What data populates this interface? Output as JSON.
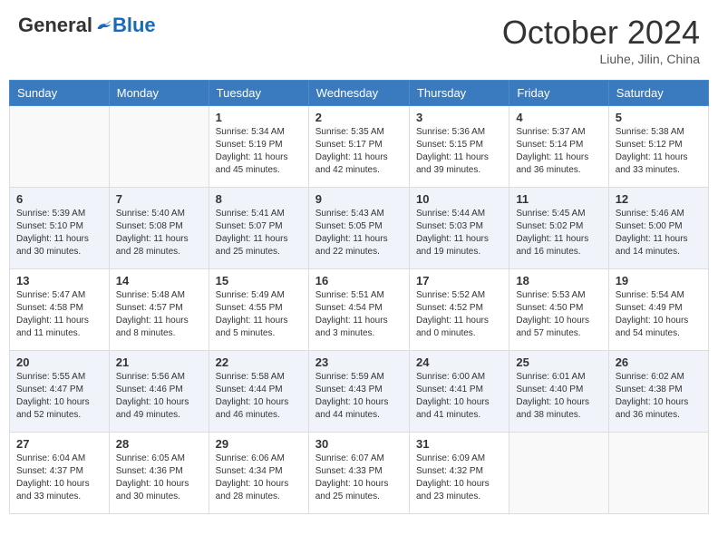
{
  "header": {
    "logo_general": "General",
    "logo_blue": "Blue",
    "month": "October 2024",
    "location": "Liuhe, Jilin, China"
  },
  "days_of_week": [
    "Sunday",
    "Monday",
    "Tuesday",
    "Wednesday",
    "Thursday",
    "Friday",
    "Saturday"
  ],
  "weeks": [
    [
      {
        "day": "",
        "info": ""
      },
      {
        "day": "",
        "info": ""
      },
      {
        "day": "1",
        "info": "Sunrise: 5:34 AM\nSunset: 5:19 PM\nDaylight: 11 hours and 45 minutes."
      },
      {
        "day": "2",
        "info": "Sunrise: 5:35 AM\nSunset: 5:17 PM\nDaylight: 11 hours and 42 minutes."
      },
      {
        "day": "3",
        "info": "Sunrise: 5:36 AM\nSunset: 5:15 PM\nDaylight: 11 hours and 39 minutes."
      },
      {
        "day": "4",
        "info": "Sunrise: 5:37 AM\nSunset: 5:14 PM\nDaylight: 11 hours and 36 minutes."
      },
      {
        "day": "5",
        "info": "Sunrise: 5:38 AM\nSunset: 5:12 PM\nDaylight: 11 hours and 33 minutes."
      }
    ],
    [
      {
        "day": "6",
        "info": "Sunrise: 5:39 AM\nSunset: 5:10 PM\nDaylight: 11 hours and 30 minutes."
      },
      {
        "day": "7",
        "info": "Sunrise: 5:40 AM\nSunset: 5:08 PM\nDaylight: 11 hours and 28 minutes."
      },
      {
        "day": "8",
        "info": "Sunrise: 5:41 AM\nSunset: 5:07 PM\nDaylight: 11 hours and 25 minutes."
      },
      {
        "day": "9",
        "info": "Sunrise: 5:43 AM\nSunset: 5:05 PM\nDaylight: 11 hours and 22 minutes."
      },
      {
        "day": "10",
        "info": "Sunrise: 5:44 AM\nSunset: 5:03 PM\nDaylight: 11 hours and 19 minutes."
      },
      {
        "day": "11",
        "info": "Sunrise: 5:45 AM\nSunset: 5:02 PM\nDaylight: 11 hours and 16 minutes."
      },
      {
        "day": "12",
        "info": "Sunrise: 5:46 AM\nSunset: 5:00 PM\nDaylight: 11 hours and 14 minutes."
      }
    ],
    [
      {
        "day": "13",
        "info": "Sunrise: 5:47 AM\nSunset: 4:58 PM\nDaylight: 11 hours and 11 minutes."
      },
      {
        "day": "14",
        "info": "Sunrise: 5:48 AM\nSunset: 4:57 PM\nDaylight: 11 hours and 8 minutes."
      },
      {
        "day": "15",
        "info": "Sunrise: 5:49 AM\nSunset: 4:55 PM\nDaylight: 11 hours and 5 minutes."
      },
      {
        "day": "16",
        "info": "Sunrise: 5:51 AM\nSunset: 4:54 PM\nDaylight: 11 hours and 3 minutes."
      },
      {
        "day": "17",
        "info": "Sunrise: 5:52 AM\nSunset: 4:52 PM\nDaylight: 11 hours and 0 minutes."
      },
      {
        "day": "18",
        "info": "Sunrise: 5:53 AM\nSunset: 4:50 PM\nDaylight: 10 hours and 57 minutes."
      },
      {
        "day": "19",
        "info": "Sunrise: 5:54 AM\nSunset: 4:49 PM\nDaylight: 10 hours and 54 minutes."
      }
    ],
    [
      {
        "day": "20",
        "info": "Sunrise: 5:55 AM\nSunset: 4:47 PM\nDaylight: 10 hours and 52 minutes."
      },
      {
        "day": "21",
        "info": "Sunrise: 5:56 AM\nSunset: 4:46 PM\nDaylight: 10 hours and 49 minutes."
      },
      {
        "day": "22",
        "info": "Sunrise: 5:58 AM\nSunset: 4:44 PM\nDaylight: 10 hours and 46 minutes."
      },
      {
        "day": "23",
        "info": "Sunrise: 5:59 AM\nSunset: 4:43 PM\nDaylight: 10 hours and 44 minutes."
      },
      {
        "day": "24",
        "info": "Sunrise: 6:00 AM\nSunset: 4:41 PM\nDaylight: 10 hours and 41 minutes."
      },
      {
        "day": "25",
        "info": "Sunrise: 6:01 AM\nSunset: 4:40 PM\nDaylight: 10 hours and 38 minutes."
      },
      {
        "day": "26",
        "info": "Sunrise: 6:02 AM\nSunset: 4:38 PM\nDaylight: 10 hours and 36 minutes."
      }
    ],
    [
      {
        "day": "27",
        "info": "Sunrise: 6:04 AM\nSunset: 4:37 PM\nDaylight: 10 hours and 33 minutes."
      },
      {
        "day": "28",
        "info": "Sunrise: 6:05 AM\nSunset: 4:36 PM\nDaylight: 10 hours and 30 minutes."
      },
      {
        "day": "29",
        "info": "Sunrise: 6:06 AM\nSunset: 4:34 PM\nDaylight: 10 hours and 28 minutes."
      },
      {
        "day": "30",
        "info": "Sunrise: 6:07 AM\nSunset: 4:33 PM\nDaylight: 10 hours and 25 minutes."
      },
      {
        "day": "31",
        "info": "Sunrise: 6:09 AM\nSunset: 4:32 PM\nDaylight: 10 hours and 23 minutes."
      },
      {
        "day": "",
        "info": ""
      },
      {
        "day": "",
        "info": ""
      }
    ]
  ]
}
